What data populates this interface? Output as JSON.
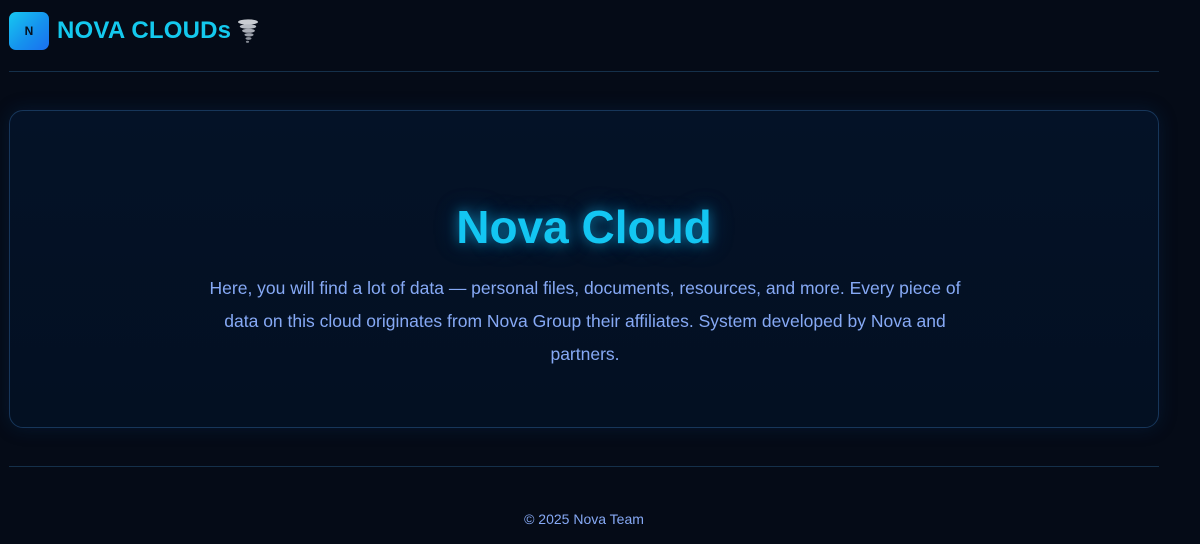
{
  "header": {
    "logo_letter": "N",
    "brand_name": "NOVA CLOUDs",
    "brand_icon": "tornado-icon"
  },
  "hero": {
    "title": "Nova Cloud",
    "description": "Here, you will find a lot of data — personal files, documents, resources, and more. Every piece of data on this cloud originates from Nova Group their affiliates. System developed by Nova and partners."
  },
  "footer": {
    "copyright": "© 2025 Nova Team"
  },
  "colors": {
    "background": "#050b17",
    "accent": "#14c9ee",
    "body_text": "#86a9f5",
    "card_border": "#17365a"
  }
}
